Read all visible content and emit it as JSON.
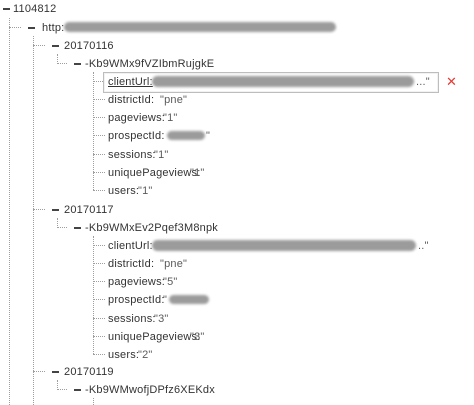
{
  "root": {
    "label": "1104812"
  },
  "url_node": {
    "label": "http:"
  },
  "groups": [
    {
      "date": "20170116",
      "push_id": "-Kb9WMx9fVZIbmRujgkE",
      "fields": [
        {
          "key": "clientUrl:",
          "value": "...\"",
          "editing": true
        },
        {
          "key": "districtId:",
          "value": "\"pne\""
        },
        {
          "key": "pageviews:",
          "value": "\"1\""
        },
        {
          "key": "prospectId:",
          "value": "\""
        },
        {
          "key": "sessions:",
          "value": "\"1\""
        },
        {
          "key": "uniquePageviews:",
          "value": "\"1\""
        },
        {
          "key": "users:",
          "value": "\"1\""
        }
      ]
    },
    {
      "date": "20170117",
      "push_id": "-Kb9WMxEv2Pqef3M8npk",
      "fields": [
        {
          "key": "clientUrl:",
          "value": "..\""
        },
        {
          "key": "districtId:",
          "value": "\"pne\""
        },
        {
          "key": "pageviews:",
          "value": "\"5\""
        },
        {
          "key": "prospectId:",
          "value": "\""
        },
        {
          "key": "sessions:",
          "value": "\"3\""
        },
        {
          "key": "uniquePageviews:",
          "value": "\"3\""
        },
        {
          "key": "users:",
          "value": "\"2\""
        }
      ]
    },
    {
      "date": "20170119",
      "push_id": "-Kb9WMwofjDPfz6XEKdx",
      "fields": []
    }
  ],
  "delete_icon": "close-icon",
  "accent": {
    "delete": "#e53935",
    "tree_lines": "#9e9e9e"
  }
}
